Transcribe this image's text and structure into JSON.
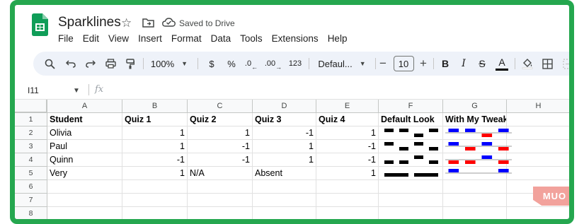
{
  "app": {
    "title": "Sparklines",
    "save_status": "Saved to Drive"
  },
  "menu": [
    "File",
    "Edit",
    "View",
    "Insert",
    "Format",
    "Data",
    "Tools",
    "Extensions",
    "Help"
  ],
  "toolbar": {
    "zoom": "100%",
    "currency": "$",
    "percent": "%",
    "decrease_decimal": ".0",
    "increase_decimal": ".00",
    "number_format": "123",
    "font_name": "Defaul...",
    "font_size": "10",
    "bold": "B",
    "italic": "I",
    "strikethrough": "S",
    "text_color": "A"
  },
  "formula_bar": {
    "cell_ref": "I11",
    "fx_label": "fx"
  },
  "columns": [
    "A",
    "B",
    "C",
    "D",
    "E",
    "F",
    "G",
    "H"
  ],
  "row_numbers": [
    "1",
    "2",
    "3",
    "4",
    "5",
    "6",
    "7",
    "8"
  ],
  "rows": [
    [
      "Student",
      "Quiz 1",
      "Quiz 2",
      "Quiz 3",
      "Quiz 4",
      "Default Look",
      "With My Tweaks",
      ""
    ],
    [
      "Olivia",
      "1",
      "1",
      "-1",
      "1",
      "",
      "",
      ""
    ],
    [
      "Paul",
      "1",
      "-1",
      "1",
      "-1",
      "",
      "",
      ""
    ],
    [
      "Quinn",
      "-1",
      "-1",
      "1",
      "-1",
      "",
      "",
      ""
    ],
    [
      "Very",
      "1",
      "N/A",
      "Absent",
      "1",
      "",
      "",
      ""
    ],
    [
      "",
      "",
      "",
      "",
      "",
      "",
      "",
      ""
    ],
    [
      "",
      "",
      "",
      "",
      "",
      "",
      "",
      ""
    ],
    [
      "",
      "",
      "",
      "",
      "",
      "",
      "",
      ""
    ]
  ],
  "sparklines": [
    [
      1,
      1,
      -1,
      1
    ],
    [
      1,
      -1,
      1,
      -1
    ],
    [
      -1,
      -1,
      1,
      -1
    ],
    [
      1,
      0,
      0,
      1
    ]
  ],
  "colors": {
    "frame": "#25a74f",
    "default_bar": "#000000",
    "tweak_positive": "#0000ff",
    "tweak_negative": "#ff0000",
    "tweak_axis": "#9e9e9e"
  },
  "watermark": "MUO"
}
